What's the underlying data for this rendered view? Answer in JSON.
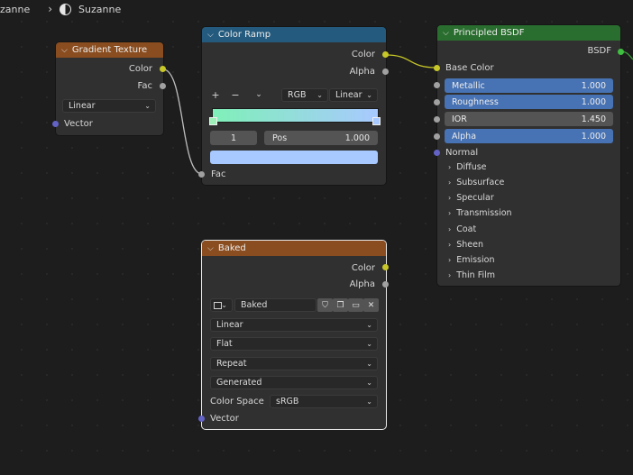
{
  "breadcrumb": {
    "object": "zanne",
    "material": "Suzanne"
  },
  "gradient_texture": {
    "title": "Gradient Texture",
    "outputs": [
      "Color",
      "Fac"
    ],
    "type_value": "Linear",
    "input_vector": "Vector"
  },
  "color_ramp": {
    "title": "Color Ramp",
    "outputs": [
      "Color",
      "Alpha"
    ],
    "add_label": "+",
    "remove_label": "−",
    "color_mode": "RGB",
    "interpolation": "Linear",
    "stop_index": "1",
    "pos_label": "Pos",
    "pos_value": "1.000",
    "stop_color": "#a8c9ff",
    "ramp_start_color": "#7ff0b8",
    "ramp_end_color": "#a8c9ff",
    "input_fac": "Fac"
  },
  "principled": {
    "title": "Principled BSDF",
    "output": "BSDF",
    "base_color": "Base Color",
    "fields": [
      {
        "label": "Metallic",
        "value": "1.000"
      },
      {
        "label": "Roughness",
        "value": "1.000"
      },
      {
        "label": "IOR",
        "value": "1.450"
      },
      {
        "label": "Alpha",
        "value": "1.000"
      }
    ],
    "normal": "Normal",
    "panels": [
      "Diffuse",
      "Subsurface",
      "Specular",
      "Transmission",
      "Coat",
      "Sheen",
      "Emission",
      "Thin Film"
    ]
  },
  "baked": {
    "title": "Baked",
    "outputs": [
      "Color",
      "Alpha"
    ],
    "image_name": "Baked",
    "interpolation": "Linear",
    "projection": "Flat",
    "extension": "Repeat",
    "source": "Generated",
    "color_space_label": "Color Space",
    "color_space": "sRGB",
    "input_vector": "Vector"
  },
  "colors": {
    "socket_color": "#c7c729",
    "socket_float": "#a1a1a1",
    "socket_vector": "#6363c7",
    "accent_blue": "#4772b3"
  }
}
